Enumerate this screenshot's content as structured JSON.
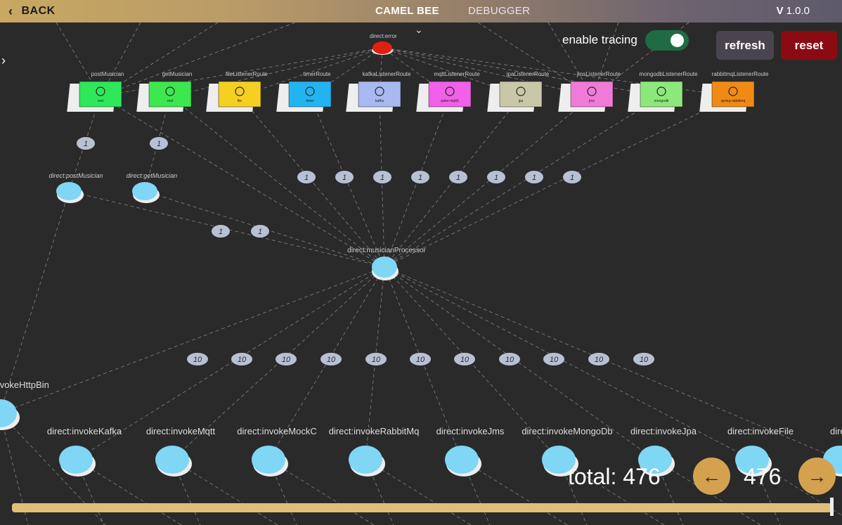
{
  "header": {
    "back_label": "BACK",
    "tabs": [
      "CAMEL BEE",
      "DEBUGGER"
    ],
    "version_prefix": "V",
    "version": "1.0.0"
  },
  "controls": {
    "tracing_label": "enable tracing",
    "tracing_enabled": true,
    "refresh_label": "refresh",
    "reset_label": "reset"
  },
  "footer": {
    "total_label": "total: 476",
    "count": "476"
  },
  "colors": {
    "accent": "#d4a24f",
    "toggle_on": "#1f6b43",
    "reset": "#8a0c12",
    "node": "#7fd6f5",
    "error": "#e02010"
  },
  "graph": {
    "error_node": "direct:error",
    "routes": [
      {
        "label": "postMusician",
        "sub": "rest",
        "color": "#2ee85a",
        "icon": "cloud-icon"
      },
      {
        "label": "getMusician",
        "sub": "rest",
        "color": "#3ce84e",
        "icon": "cloud-icon"
      },
      {
        "label": "fileListenerRoute",
        "sub": "file",
        "color": "#f5d020",
        "icon": "folder-icon"
      },
      {
        "label": "timerRoute",
        "sub": "timer",
        "color": "#22b4f0",
        "icon": "timer-icon"
      },
      {
        "label": "kafkaListenerRoute",
        "sub": "kafka",
        "color": "#a8b8f0",
        "icon": "kafka-icon"
      },
      {
        "label": "mqttListenerRoute",
        "sub": "paho-mqtt5",
        "color": "#f060e8",
        "icon": "rss-icon"
      },
      {
        "label": "jpaListenerRoute",
        "sub": "jpa",
        "color": "#c8c8a8",
        "icon": "database-icon"
      },
      {
        "label": "jmsListenerRoute",
        "sub": "jms",
        "color": "#f07ad8",
        "icon": "chain-icon"
      },
      {
        "label": "mongodbListenerRoute",
        "sub": "mongodb",
        "color": "#8ce87a",
        "icon": "mongodb-icon"
      },
      {
        "label": "rabbitmqListenerRoute",
        "sub": "spring-rabbitmq",
        "color": "#f08a14",
        "icon": "rabbitmq-icon"
      }
    ],
    "direct_top": [
      "direct:postMusician",
      "direct:getMusician"
    ],
    "processor": "direct:musicianProcessor",
    "top_counts": [
      "1",
      "1"
    ],
    "mid_counts": [
      "1",
      "1",
      "1",
      "1",
      "1",
      "1",
      "1",
      "1"
    ],
    "proc_counts": [
      "1",
      "1"
    ],
    "bottom_counts": [
      "10",
      "10",
      "10",
      "10",
      "10",
      "10",
      "10",
      "10",
      "10",
      "10",
      "10"
    ],
    "invoke_nodes": [
      "direct:invokeHttpBin",
      "direct:invokeKafka",
      "direct:invokeMqtt",
      "direct:invokeMockC",
      "direct:invokeRabbitMq",
      "direct:invokeJms",
      "direct:invokeMongoDb",
      "direct:invokeJpa",
      "direct:invokeFile",
      "direct:inv"
    ]
  }
}
